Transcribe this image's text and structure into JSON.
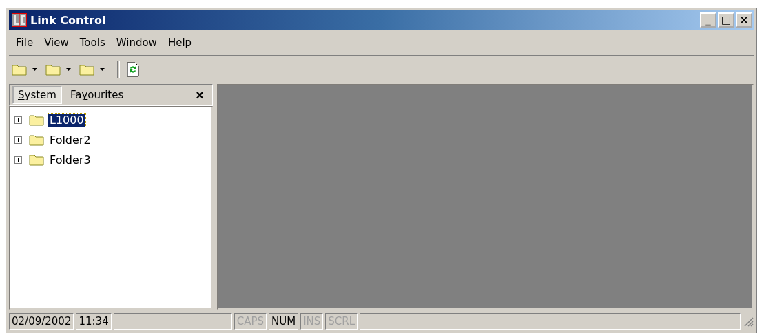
{
  "window": {
    "title": "Link Control",
    "controls": [
      "_",
      "□",
      "×"
    ]
  },
  "menu": [
    {
      "key": "F",
      "after": "ile"
    },
    {
      "key": "V",
      "after": "iew"
    },
    {
      "key": "T",
      "after": "ools"
    },
    {
      "key": "W",
      "after": "indow"
    },
    {
      "key": "H",
      "after": "elp"
    }
  ],
  "toolbar": [
    {
      "kind": "folder-dropdown"
    },
    {
      "kind": "folder-dropdown"
    },
    {
      "kind": "folder-dropdown"
    },
    {
      "kind": "separator"
    },
    {
      "kind": "refresh"
    }
  ],
  "panel": {
    "tabs": [
      {
        "key": "S",
        "after": "ystem",
        "selected": true
      },
      {
        "before": "Fa",
        "key": "y",
        "after": "ourites",
        "selected": false
      }
    ],
    "close": "×",
    "tree": [
      {
        "label": "L1000",
        "selected": true,
        "expanded": false
      },
      {
        "label": "Folder2",
        "selected": false,
        "expanded": false
      },
      {
        "label": "Folder3",
        "selected": false,
        "expanded": false
      }
    ]
  },
  "status_bar": {
    "date": "02/09/2002",
    "time": "11:34",
    "indicators": [
      {
        "label": "CAPS",
        "active": false
      },
      {
        "label": "NUM",
        "active": true
      },
      {
        "label": "INS",
        "active": false
      },
      {
        "label": "SCRL",
        "active": false
      }
    ]
  }
}
